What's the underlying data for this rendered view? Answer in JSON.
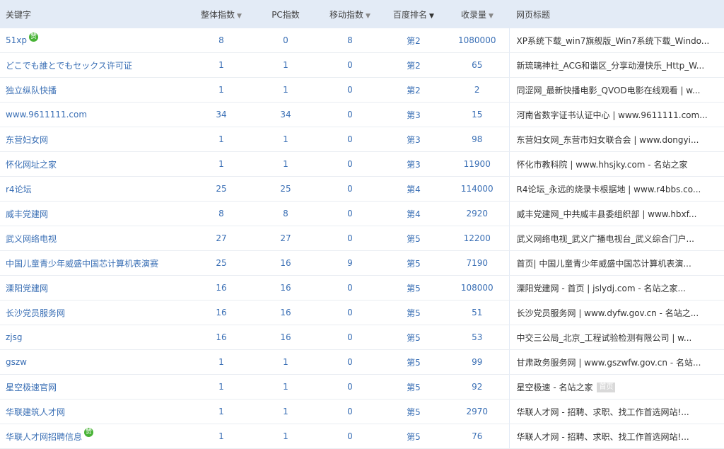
{
  "header": {
    "keyword": "关键字",
    "overall_index": "整体指数",
    "pc_index": "PC指数",
    "mobile_index": "移动指数",
    "baidu_rank": "百度排名",
    "indexed": "收录量",
    "page_title": "网页标题"
  },
  "badge_label": "赞",
  "home_tag": "首页",
  "rows": [
    {
      "keyword": "51xp",
      "overall": "8",
      "pc": "0",
      "mobile": "8",
      "rank": "第2",
      "indexed": "1080000",
      "title": "XP系统下载_win7旗舰版_Win7系统下载_Windo...",
      "badge": true
    },
    {
      "keyword": "どこでも誰とでもセックス许可证",
      "overall": "1",
      "pc": "1",
      "mobile": "0",
      "rank": "第2",
      "indexed": "65",
      "title": "新琉璃神社_ACG和谐区_分享动漫快乐_Http_W..."
    },
    {
      "keyword": "独立纵队快播",
      "overall": "1",
      "pc": "1",
      "mobile": "0",
      "rank": "第2",
      "indexed": "2",
      "title": "同涩网_最新快播电影_QVOD电影在线观看 | w..."
    },
    {
      "keyword": "www.9611111.com",
      "overall": "34",
      "pc": "34",
      "mobile": "0",
      "rank": "第3",
      "indexed": "15",
      "title": "河南省数字证书认证中心 | www.9611111.com..."
    },
    {
      "keyword": "东营妇女网",
      "overall": "1",
      "pc": "1",
      "mobile": "0",
      "rank": "第3",
      "indexed": "98",
      "title": "东营妇女网_东营市妇女联合会 | www.dongyi..."
    },
    {
      "keyword": "怀化网址之家",
      "overall": "1",
      "pc": "1",
      "mobile": "0",
      "rank": "第3",
      "indexed": "11900",
      "title": "怀化市教科院 | www.hhsjky.com - 名站之家"
    },
    {
      "keyword": "r4论坛",
      "overall": "25",
      "pc": "25",
      "mobile": "0",
      "rank": "第4",
      "indexed": "114000",
      "title": "R4论坛_永远的烧录卡根据地 | www.r4bbs.co..."
    },
    {
      "keyword": "威丰党建网",
      "overall": "8",
      "pc": "8",
      "mobile": "0",
      "rank": "第4",
      "indexed": "2920",
      "title": "威丰党建网_中共威丰县委组织部 | www.hbxf..."
    },
    {
      "keyword": "武义网络电视",
      "overall": "27",
      "pc": "27",
      "mobile": "0",
      "rank": "第5",
      "indexed": "12200",
      "title": "武义网络电视_武义广播电视台_武义综合门户..."
    },
    {
      "keyword": "中国儿童青少年威盛中国芯计算机表演赛",
      "overall": "25",
      "pc": "16",
      "mobile": "9",
      "rank": "第5",
      "indexed": "7190",
      "title": "首页| 中国儿童青少年威盛中国芯计算机表演..."
    },
    {
      "keyword": "溧阳党建网",
      "overall": "16",
      "pc": "16",
      "mobile": "0",
      "rank": "第5",
      "indexed": "108000",
      "title": "溧阳党建网 - 首页 | jslydj.com - 名站之家..."
    },
    {
      "keyword": "长沙党员服务网",
      "overall": "16",
      "pc": "16",
      "mobile": "0",
      "rank": "第5",
      "indexed": "51",
      "title": "长沙党员服务网 | www.dyfw.gov.cn - 名站之..."
    },
    {
      "keyword": "zjsg",
      "overall": "16",
      "pc": "16",
      "mobile": "0",
      "rank": "第5",
      "indexed": "53",
      "title": "中交三公局_北京_工程试验检测有限公司 | w..."
    },
    {
      "keyword": "gszw",
      "overall": "1",
      "pc": "1",
      "mobile": "0",
      "rank": "第5",
      "indexed": "99",
      "title": "甘肃政务服务网 | www.gszwfw.gov.cn - 名站..."
    },
    {
      "keyword": "星空极速官网",
      "overall": "1",
      "pc": "1",
      "mobile": "0",
      "rank": "第5",
      "indexed": "92",
      "title": "星空极速 - 名站之家",
      "home": true
    },
    {
      "keyword": "华联建筑人才网",
      "overall": "1",
      "pc": "1",
      "mobile": "0",
      "rank": "第5",
      "indexed": "2970",
      "title": "华联人才网 - 招聘、求职、找工作首选网站!..."
    },
    {
      "keyword": "华联人才网招聘信息",
      "overall": "1",
      "pc": "1",
      "mobile": "0",
      "rank": "第5",
      "indexed": "76",
      "title": "华联人才网 - 招聘、求职、找工作首选网站!...",
      "badge": true
    }
  ]
}
